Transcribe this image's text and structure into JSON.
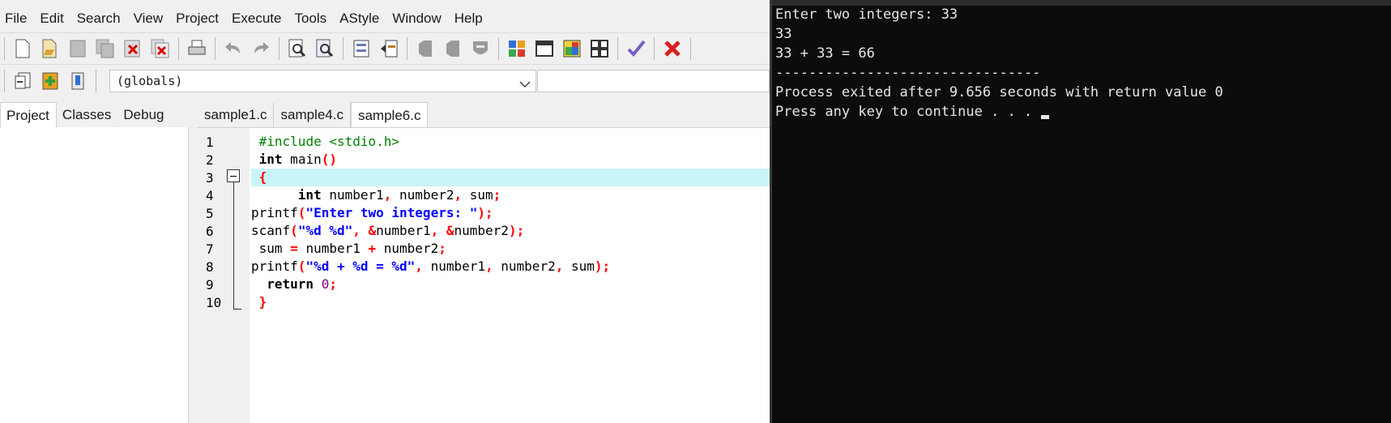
{
  "menu": [
    "File",
    "Edit",
    "Search",
    "View",
    "Project",
    "Execute",
    "Tools",
    "AStyle",
    "Window",
    "Help"
  ],
  "toolbar": {
    "icons": [
      "new-file-icon",
      "open-file-icon",
      "save-icon",
      "save-all-icon",
      "close-icon",
      "close-all-icon",
      "print-icon",
      "undo-icon",
      "redo-icon",
      "find-icon",
      "replace-icon",
      "indent-icon",
      "unindent-icon",
      "bookmark-toggle-icon",
      "bookmark-prev-icon",
      "bookmark-next-icon",
      "compile-icon",
      "run-icon",
      "compile-run-icon",
      "rebuild-all-icon",
      "syntax-check-icon",
      "stop-execution-icon"
    ]
  },
  "scope_combo": {
    "value": "(globals)"
  },
  "left_tabs": [
    "Project",
    "Classes",
    "Debug"
  ],
  "editor_tabs": [
    "sample1.c",
    "sample4.c",
    "sample6.c"
  ],
  "line_numbers": [
    "1",
    "2",
    "3",
    "4",
    "5",
    "6",
    "7",
    "8",
    "9",
    "10"
  ],
  "code": {
    "l1": "#include <stdio.h>",
    "l2_kw": "int",
    "l2_id": " main",
    "l2_br": "()",
    "l3_br": "{",
    "l4_kw": "int",
    "l4_id": " number1",
    "l4_c1": ",",
    "l4_id2": " number2",
    "l4_c2": ",",
    "l4_id3": " sum",
    "l4_c3": ";",
    "l5_id": "printf",
    "l5_p1": "(",
    "l5_st": "\"Enter two integers: \"",
    "l5_p2": ");",
    "l6_id": "scanf",
    "l6_p1": "(",
    "l6_st": "\"%d %d\"",
    "l6_c1": ",",
    "l6_amp1": " &",
    "l6_id2": "number1",
    "l6_c2": ",",
    "l6_amp2": " &",
    "l6_id3": "number2",
    "l6_p2": ");",
    "l7_id": "sum",
    "l7_op": " =",
    "l7_id2": " number1",
    "l7_op2": " +",
    "l7_id3": " number2",
    "l7_c": ";",
    "l8_id": "printf",
    "l8_p1": "(",
    "l8_st": "\"%d + %d = %d\"",
    "l8_c1": ",",
    "l8_id2": " number1",
    "l8_c2": ",",
    "l8_id3": " number2",
    "l8_c3": ",",
    "l8_id4": " sum",
    "l8_p2": ");",
    "l9_kw": "return",
    "l9_nm": " 0",
    "l9_c": ";",
    "l10_br": "}"
  },
  "console": {
    "lines": [
      "Enter two integers: 33",
      "33",
      "33 + 33 = 66",
      "--------------------------------",
      "Process exited after 9.656 seconds with return value 0",
      "Press any key to continue . . . "
    ]
  }
}
